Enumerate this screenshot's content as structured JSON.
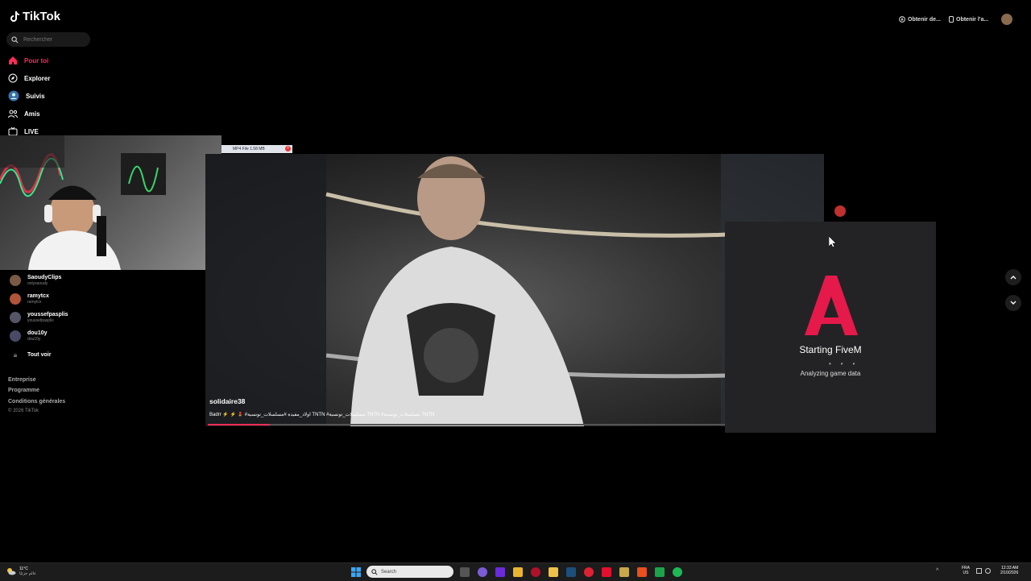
{
  "app": {
    "name": "TikTok"
  },
  "search": {
    "placeholder": "Rechercher"
  },
  "nav": [
    {
      "label": "Pour toi",
      "icon": "home-icon"
    },
    {
      "label": "Explorer",
      "icon": "compass-icon"
    },
    {
      "label": "Suivis",
      "icon": "following-icon"
    },
    {
      "label": "Amis",
      "icon": "friends-icon"
    },
    {
      "label": "LIVE",
      "icon": "live-icon"
    }
  ],
  "accounts": [
    {
      "name": "SaoudyClips",
      "handle": "onlysaoudy"
    },
    {
      "name": "ramytcx",
      "handle": "ramytcx"
    },
    {
      "name": "youssefpasplis",
      "handle": "youssefpasplis"
    },
    {
      "name": "dou10y",
      "handle": "dou10y"
    }
  ],
  "see_all": "Tout voir",
  "footer": {
    "links": [
      "Entreprise",
      "Programme",
      "Conditions générales"
    ],
    "copyright": "© 2026 TikTok"
  },
  "topbar": {
    "get_app": "Obtenir de...",
    "get_app2": "Obtenir l'a..."
  },
  "overlay_badge": "MP4 File 1.58 MB",
  "video": {
    "author": "solidaire38",
    "caption": "Badrr ⚡ ⚡ 💄 #اولاد_مفيدة #مسلسلات_تونسية TNTN #مسلسلات_تونسية TNTN #مسلسلات_تونسية TNTN"
  },
  "fivem": {
    "title": "Starting FiveM",
    "status": "Analyzing game data"
  },
  "taskbar": {
    "weather_temp": "11°C",
    "weather_desc": "عالم جزئيًا",
    "search": "Search",
    "lang1": "FRA",
    "lang2": "US",
    "time": "12:33 AM",
    "date": "2/10/2026"
  },
  "colors": {
    "accent": "#fe2c55",
    "fivem_red": "#e5194a",
    "background": "#000000"
  }
}
